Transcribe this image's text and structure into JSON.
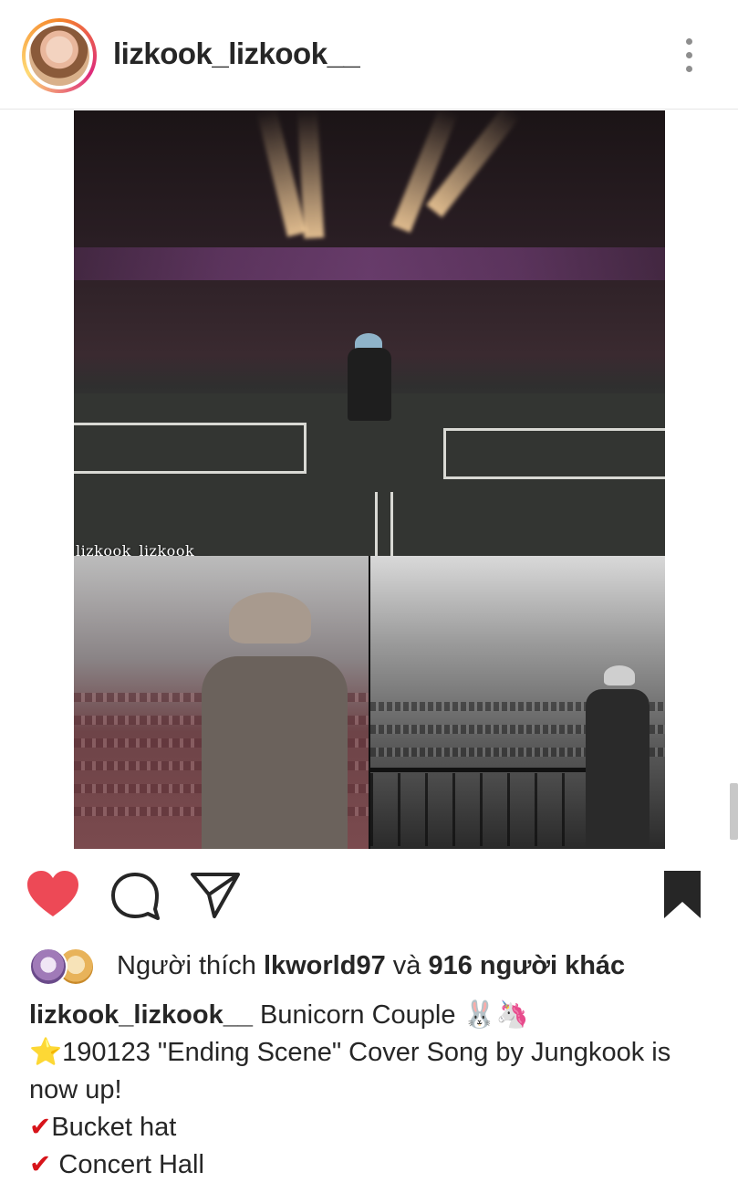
{
  "header": {
    "username": "lizkook_lizkook__",
    "more_icon": "more-vertical-icon"
  },
  "post": {
    "watermark": "lizkook_lizkook__"
  },
  "actions": {
    "like_icon": "heart-icon",
    "comment_icon": "comment-icon",
    "share_icon": "send-icon",
    "save_icon": "bookmark-icon",
    "liked": true,
    "like_color": "#ed4956"
  },
  "likes": {
    "prefix": "Người thích ",
    "user": "lkworld97",
    "middle": " và ",
    "count_text": "916 người khác"
  },
  "caption": {
    "username": "lizkook_lizkook__",
    "title": " Bunicorn Couple 🐰🦄",
    "line2_star": "⭐",
    "line2": "190123 \"Ending Scene\" Cover Song by Jungkook is",
    "line3": "now up!",
    "check": "✔",
    "item1": "Bucket hat",
    "item2": " Concert Hall"
  }
}
